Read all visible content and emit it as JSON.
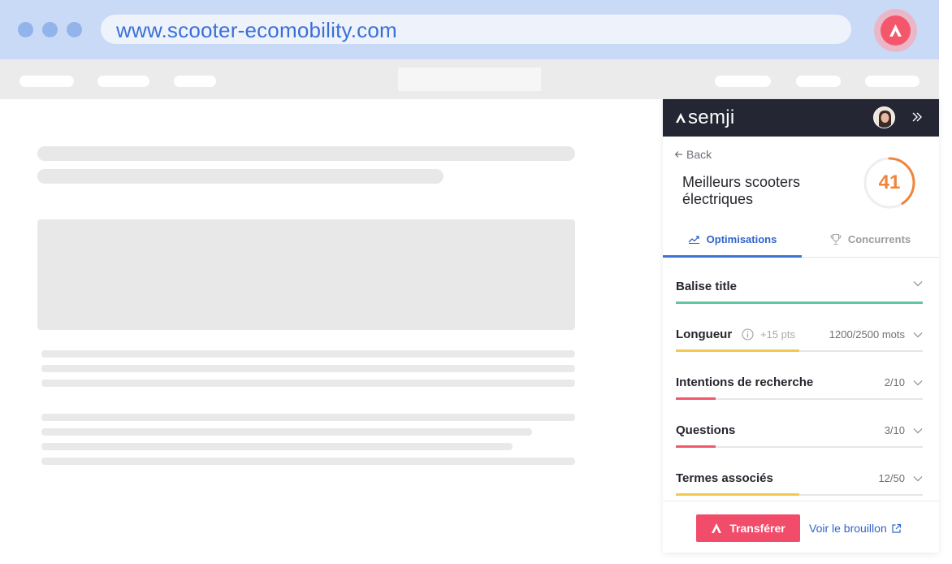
{
  "browser": {
    "url": "www.scooter-ecomobility.com",
    "extension_icon": "semji-logo-icon"
  },
  "panel": {
    "brand": "semji",
    "back_label": "Back",
    "topic_title": "Meilleurs scooters électriques",
    "score": "41",
    "score_fraction": 0.41,
    "tabs": [
      {
        "label": "Optimisations",
        "icon": "trend-icon",
        "active": true
      },
      {
        "label": "Concurrents",
        "icon": "trophy-icon",
        "active": false
      }
    ],
    "optimisations": [
      {
        "label": "Balise title",
        "value": "",
        "bonus": "",
        "progress": 1.0,
        "color": "#5ec9a0"
      },
      {
        "label": "Longueur",
        "value": "1200/2500 mots",
        "bonus": "+15 pts",
        "progress": 0.5,
        "color": "#f2c94c"
      },
      {
        "label": "Intentions de recherche",
        "value": "2/10",
        "bonus": "",
        "progress": 0.16,
        "color": "#f1596b"
      },
      {
        "label": "Questions",
        "value": "3/10",
        "bonus": "",
        "progress": 0.16,
        "color": "#f1596b"
      },
      {
        "label": "Termes associés",
        "value": "12/50",
        "bonus": "",
        "progress": 0.5,
        "color": "#f2c94c"
      }
    ],
    "footer": {
      "transfer_label": "Transférer",
      "draft_label": "Voir le brouillon"
    }
  },
  "colors": {
    "accent": "#2f64c9",
    "brand_red": "#f14c6a",
    "score_orange": "#f0843a",
    "panel_header": "#252633"
  }
}
